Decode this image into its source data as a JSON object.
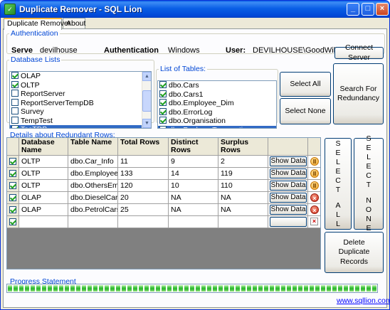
{
  "window": {
    "title": "Duplicate Remover - SQL Lion",
    "buttons": {
      "minimize": "_",
      "maximize": "□",
      "close": "×"
    }
  },
  "tabs": [
    {
      "label": "Duplicate Remover",
      "active": true
    },
    {
      "label": "About",
      "active": false
    }
  ],
  "authentication": {
    "legend": "Authentication",
    "server_label": "Serve",
    "server_value": "devilhouse",
    "auth_label": "Authentication",
    "auth_value": "Windows",
    "user_label": "User:",
    "user_value": "DEVILHOUSE\\GoodWill",
    "connect_button": "Connect Server"
  },
  "database_lists": {
    "legend": "Database Lists",
    "items": [
      {
        "label": "OLAP",
        "checked": true,
        "selected": false
      },
      {
        "label": "OLTP",
        "checked": true,
        "selected": false
      },
      {
        "label": "ReportServer",
        "checked": false,
        "selected": false
      },
      {
        "label": "ReportServerTempDB",
        "checked": false,
        "selected": false
      },
      {
        "label": "Survey",
        "checked": false,
        "selected": false
      },
      {
        "label": "TempTest",
        "checked": false,
        "selected": false
      },
      {
        "label": "TesTDB",
        "checked": true,
        "selected": true
      }
    ]
  },
  "tables_list": {
    "legend": "List of Tables:",
    "items": [
      {
        "label": "dbo.Cars",
        "checked": true,
        "selected": false
      },
      {
        "label": "dbo.Cars1",
        "checked": true,
        "selected": false
      },
      {
        "label": "dbo.Employee_Dim",
        "checked": true,
        "selected": false
      },
      {
        "label": "dbo.ErrorLog",
        "checked": true,
        "selected": false
      },
      {
        "label": "dbo.Organisation",
        "checked": true,
        "selected": false
      },
      {
        "label": "dbo.PackageTransaction",
        "checked": true,
        "selected": true
      }
    ],
    "select_all": "Select All",
    "select_none": "Select None",
    "search_button": "Search For Redundancy"
  },
  "details": {
    "legend": "Details about Redundant Rows:",
    "columns": [
      "Database Name",
      "Table Name",
      "Total Rows",
      "Distinct Rows",
      "Surplus Rows"
    ],
    "rows": [
      {
        "checked": true,
        "database": "OLTP",
        "table": "dbo.Car_Info",
        "total": "11",
        "distinct": "9",
        "surplus": "2",
        "action": "Show Data",
        "status": "pause"
      },
      {
        "checked": true,
        "database": "OLTP",
        "table": "dbo.Employee...",
        "total": "133",
        "distinct": "14",
        "surplus": "119",
        "action": "Show Data",
        "status": "pause"
      },
      {
        "checked": true,
        "database": "OLTP",
        "table": "dbo.OthersEm...",
        "total": "120",
        "distinct": "10",
        "surplus": "110",
        "action": "Show Data",
        "status": "pause"
      },
      {
        "checked": true,
        "database": "OLAP",
        "table": "dbo.DieselCars",
        "total": "20",
        "distinct": "NA",
        "surplus": "NA",
        "action": "Show Data",
        "status": "error"
      },
      {
        "checked": true,
        "database": "OLAP",
        "table": "dbo.PetrolCars",
        "total": "25",
        "distinct": "NA",
        "surplus": "NA",
        "action": "Show Data",
        "status": "error"
      }
    ],
    "new_row_checked": true,
    "select_all_vertical": [
      "S",
      "E",
      "L",
      "E",
      "C",
      "T",
      "",
      "A",
      "L",
      "L"
    ],
    "select_none_vertical": [
      "S",
      "E",
      "L",
      "E",
      "C",
      "T",
      "",
      "N",
      "O",
      "N",
      "E"
    ],
    "delete_button": "Delete Duplicate Records"
  },
  "progress": {
    "legend": "Progress Statement",
    "value": 1.0
  },
  "footer_link": "www.sqllion.com",
  "colors": {
    "title_bar": "#0a5fe6",
    "legend_text": "#0046d5",
    "selection": "#316ac5",
    "progress": "#2fb42f",
    "grid_background": "#808080"
  }
}
